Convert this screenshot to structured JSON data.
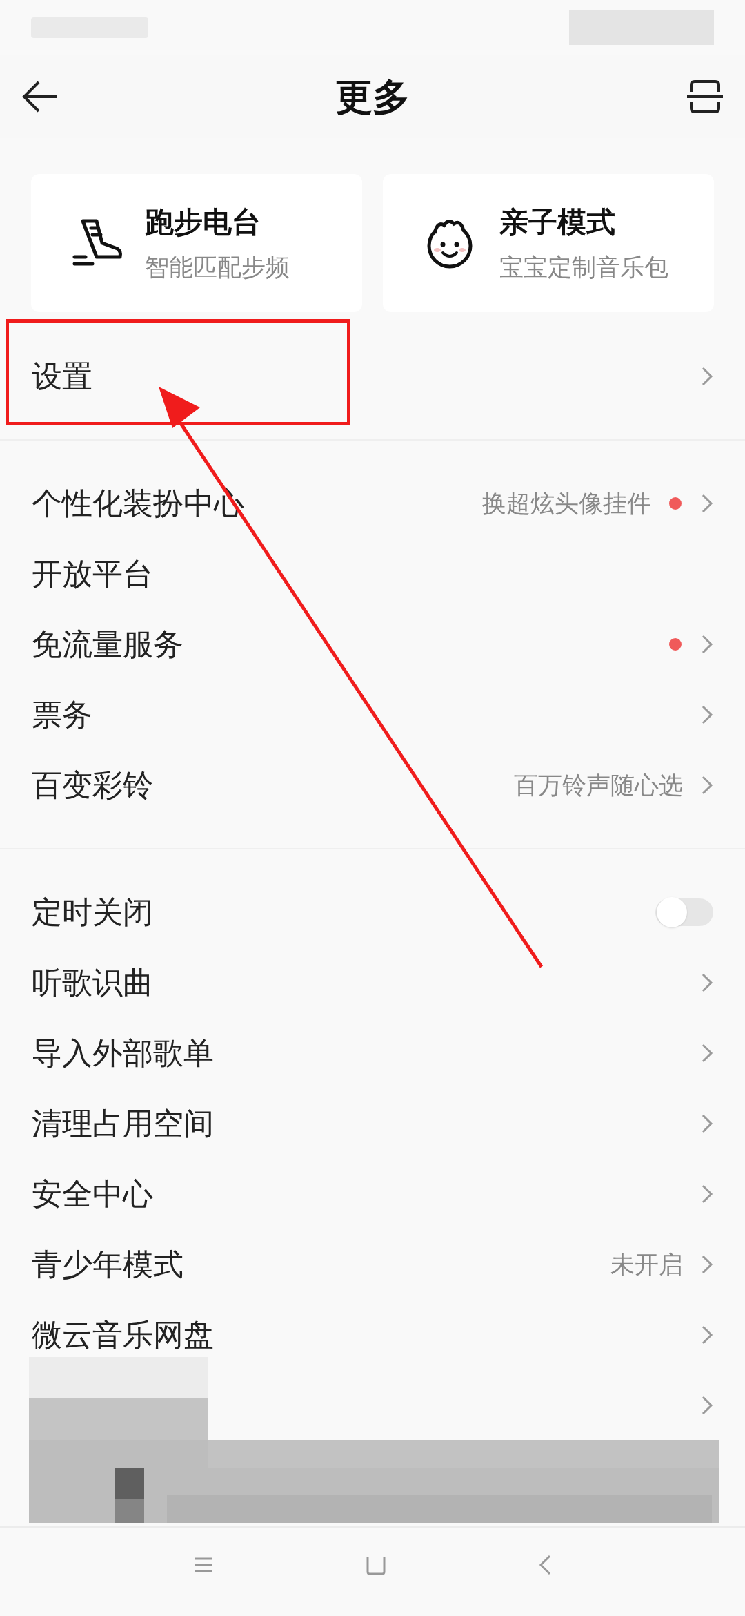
{
  "header": {
    "title": "更多"
  },
  "feature_cards": [
    {
      "kind": "shoe",
      "title": "跑步电台",
      "subtitle": "智能匹配步频"
    },
    {
      "kind": "baby",
      "title": "亲子模式",
      "subtitle": "宝宝定制音乐包"
    }
  ],
  "sections": [
    {
      "items": [
        {
          "kind": "link",
          "label": "设置",
          "dot": false
        }
      ]
    },
    {
      "items": [
        {
          "kind": "link",
          "label": "个性化装扮中心",
          "value": "换超炫头像挂件",
          "dot": true
        },
        {
          "kind": "plain",
          "label": "开放平台",
          "dot": false
        },
        {
          "kind": "link",
          "label": "免流量服务",
          "dot": true
        },
        {
          "kind": "link",
          "label": "票务",
          "dot": false
        },
        {
          "kind": "link",
          "label": "百变彩铃",
          "value": "百万铃声随心选",
          "dot": false
        }
      ]
    },
    {
      "items": [
        {
          "kind": "toggle",
          "label": "定时关闭",
          "on": false,
          "dot": false
        },
        {
          "kind": "link",
          "label": "听歌识曲",
          "dot": false
        },
        {
          "kind": "link",
          "label": "导入外部歌单",
          "dot": false
        },
        {
          "kind": "link",
          "label": "清理占用空间",
          "dot": false
        },
        {
          "kind": "link",
          "label": "安全中心",
          "dot": false
        },
        {
          "kind": "link",
          "label": "青少年模式",
          "value": "未开启",
          "dot": false
        },
        {
          "kind": "link",
          "label": "微云音乐网盘",
          "dot": false
        },
        {
          "kind": "link",
          "dot": false
        }
      ]
    }
  ]
}
